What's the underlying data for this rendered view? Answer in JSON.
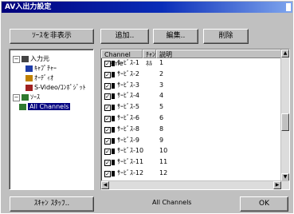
{
  "window": {
    "title": "AV入出力設定"
  },
  "toolbar": {
    "view_button": "ｿｰｽを非表示",
    "add_button": "追加..",
    "edit_button": "編集..",
    "delete_button": "削除"
  },
  "tree": {
    "items": [
      {
        "label": "入力元",
        "icon": "plug-icon",
        "indent": 0,
        "expander": "−"
      },
      {
        "label": "ｷｬﾌﾟﾁｬｰ",
        "icon": "capture-card-icon",
        "indent": 2
      },
      {
        "label": "ｵｰﾃﾞｨｵ",
        "icon": "audio-icon",
        "indent": 2
      },
      {
        "label": "S-Video/ｺﾝﾎﾟｼﾞｯﾄ",
        "icon": "video-input-icon",
        "indent": 2
      },
      {
        "label": "ｿｰｽ",
        "icon": "source-icon",
        "indent": 0,
        "expander": "−"
      },
      {
        "label": "All Channels",
        "icon": "channels-icon",
        "indent": 1,
        "selected": true
      }
    ]
  },
  "table": {
    "headers": [
      "Channel Name",
      "ﾁｬﾝﾈﾙ",
      "説明"
    ],
    "rows": [
      {
        "name": "ｻｰﾋﾞｽ-1",
        "ch": "1"
      },
      {
        "name": "ｻｰﾋﾞｽ-2",
        "ch": "2"
      },
      {
        "name": "ｻｰﾋﾞｽ-3",
        "ch": "3"
      },
      {
        "name": "ｻｰﾋﾞｽ-4",
        "ch": "4"
      },
      {
        "name": "ｻｰﾋﾞｽ-5",
        "ch": "5"
      },
      {
        "name": "ｻｰﾋﾞｽ-6",
        "ch": "6"
      },
      {
        "name": "ｻｰﾋﾞｽ-8",
        "ch": "8"
      },
      {
        "name": "ｻｰﾋﾞｽ-9",
        "ch": "9"
      },
      {
        "name": "ｻｰﾋﾞｽ-10",
        "ch": "10"
      },
      {
        "name": "ｻｰﾋﾞｽ-11",
        "ch": "11"
      },
      {
        "name": "ｻｰﾋﾞｽ-12",
        "ch": "12"
      }
    ]
  },
  "footer": {
    "left_button": "ｽｷｬﾝ ｽﾀｯﾌ..",
    "status": "All Channels",
    "ok_button": "OK"
  },
  "colors": {
    "title_start": "#00007b",
    "selection": "#000080"
  }
}
